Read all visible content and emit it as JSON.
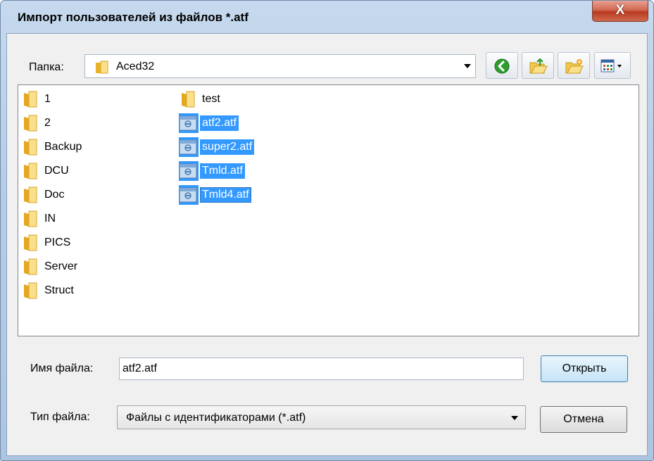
{
  "window": {
    "title": "Импорт пользователей из файлов *.atf",
    "close_symbol": "X"
  },
  "toolbar": {
    "folder_label": "Папка:",
    "current_folder": "Aced32",
    "buttons": [
      {
        "name": "back",
        "icon": "green-back-arrow-icon"
      },
      {
        "name": "up-folder",
        "icon": "folder-up-icon"
      },
      {
        "name": "new-folder",
        "icon": "new-folder-icon"
      },
      {
        "name": "view-menu",
        "icon": "view-menu-icon"
      }
    ]
  },
  "files": {
    "column1": [
      {
        "name": "1",
        "type": "folder"
      },
      {
        "name": "2",
        "type": "folder"
      },
      {
        "name": "Backup",
        "type": "folder"
      },
      {
        "name": "DCU",
        "type": "folder"
      },
      {
        "name": "Doc",
        "type": "folder"
      },
      {
        "name": "IN",
        "type": "folder"
      },
      {
        "name": "PICS",
        "type": "folder"
      },
      {
        "name": "Server",
        "type": "folder"
      },
      {
        "name": "Struct",
        "type": "folder"
      }
    ],
    "column2": [
      {
        "name": "test",
        "type": "folder",
        "selected": false
      },
      {
        "name": "atf2.atf",
        "type": "atf",
        "selected": true
      },
      {
        "name": "super2.atf",
        "type": "atf",
        "selected": true
      },
      {
        "name": "Tmld.atf",
        "type": "atf",
        "selected": true
      },
      {
        "name": "Tmld4.atf",
        "type": "atf",
        "selected": true,
        "focused": true
      }
    ]
  },
  "filename": {
    "label": "Имя файла:",
    "value": "atf2.atf"
  },
  "filetype": {
    "label": "Тип файла:",
    "value": "Файлы с идентификаторами (*.atf)"
  },
  "buttons": {
    "open": "Открыть",
    "cancel": "Отмена"
  },
  "colors": {
    "selection": "#3399ff",
    "frame": "#b7cce6",
    "close": "#c4472d"
  }
}
